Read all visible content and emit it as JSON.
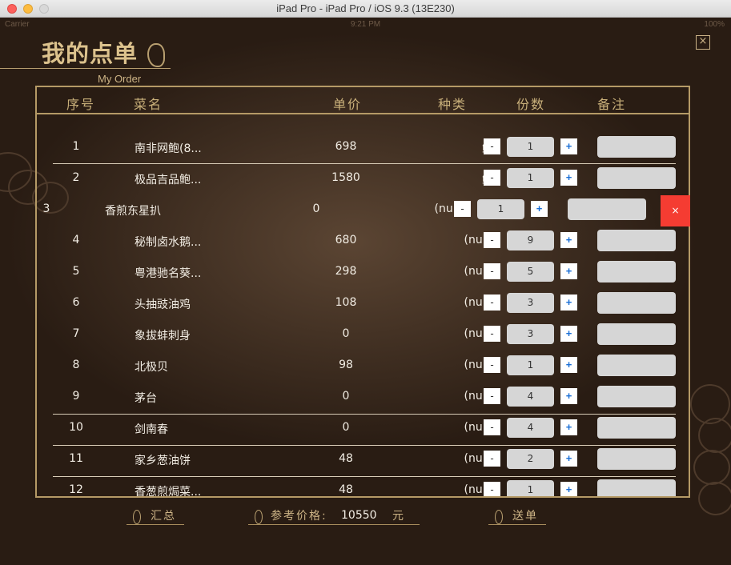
{
  "window": {
    "title": "iPad Pro - iPad Pro / iOS 9.3 (13E230)"
  },
  "statusbar": {
    "carrier": "Carrier",
    "time": "9:21 PM",
    "battery": "100%"
  },
  "page": {
    "title_cn": "我的点单",
    "title_en": "My Order",
    "close_label": "×"
  },
  "table": {
    "columns": [
      "序号",
      "菜名",
      "单价",
      "种类",
      "份数",
      "备注"
    ],
    "rows": [
      {
        "idx": "1",
        "name": "南非网鲍(8...",
        "price": "698",
        "kind": "鲍",
        "qty": "1"
      },
      {
        "idx": "2",
        "name": "极品吉品鲍...",
        "price": "1580",
        "kind": "鲍",
        "qty": "1"
      },
      {
        "idx": "3",
        "name": "香煎东星扒",
        "price": "0",
        "kind": "(null)",
        "qty": "1"
      },
      {
        "idx": "4",
        "name": "秘制卤水鹅...",
        "price": "680",
        "kind": "(null)",
        "qty": "9"
      },
      {
        "idx": "5",
        "name": "粤港驰名葵...",
        "price": "298",
        "kind": "(null)",
        "qty": "5"
      },
      {
        "idx": "6",
        "name": "头抽豉油鸡",
        "price": "108",
        "kind": "(null)",
        "qty": "3"
      },
      {
        "idx": "7",
        "name": "象拔蚌刺身",
        "price": "0",
        "kind": "(null)",
        "qty": "3"
      },
      {
        "idx": "8",
        "name": "北极贝",
        "price": "98",
        "kind": "(null)",
        "qty": "1"
      },
      {
        "idx": "9",
        "name": "茅台",
        "price": "0",
        "kind": "(null)",
        "qty": "4"
      },
      {
        "idx": "10",
        "name": "剑南春",
        "price": "0",
        "kind": "(null)",
        "qty": "4"
      },
      {
        "idx": "11",
        "name": "家乡葱油饼",
        "price": "48",
        "kind": "(null)",
        "qty": "2"
      },
      {
        "idx": "12",
        "name": "香葱煎焗菜...",
        "price": "48",
        "kind": "(null)",
        "qty": "1"
      }
    ],
    "minus_label": "-",
    "plus_label": "+",
    "delete_label": "×"
  },
  "footer": {
    "summary_label": "汇总",
    "ref_price_label": "参考价格:",
    "total": "10550",
    "currency": "元",
    "submit_label": "送单"
  }
}
